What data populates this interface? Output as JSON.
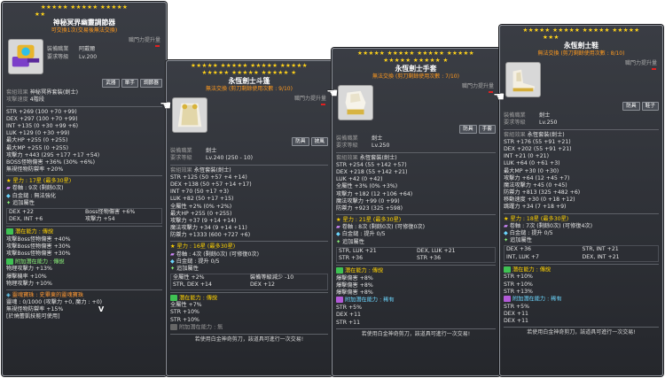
{
  "t1": {
    "stars": "★★★★★ ★★★★★ ★★★★★",
    "stars2": "★★",
    "title": "神秘冥界幽靈調節器",
    "sub": "可交換1次(交易後無法交換)",
    "power": "職門力提升量",
    "info": [
      [
        "裝備職業",
        "阿戴爾"
      ],
      [
        "要求等級",
        "Lv.200"
      ],
      [
        "套組效果",
        "神秘冥界套裝(劍士)"
      ],
      [
        "攻擊速度",
        "4階段"
      ]
    ],
    "chips": [
      "武器",
      "單手",
      "調節器"
    ],
    "stats": [
      "STR +269 (100 +70 +99)",
      "DEX +297 (100 +70 +99)",
      "INT +135 (0 +30 +99 +6)",
      "LUK +129 (0 +30 +99)",
      "最大HP +255 (0 +255)",
      "最大MP +255 (0 +255)",
      "攻擊力 +443 (295 +177 +17 +54)",
      "BOSS怪物傷害 +36% (30% +6%)",
      "無視怪物防禦率 +20%"
    ],
    "star_force": "星力 : 17星 (最多30星)",
    "rolls": "卷軸 : 9次 (剩餘0次)",
    "hammer": "白金鎚 : 無法強化",
    "extra_label": "追加屬性",
    "extra": [
      "DEX +22",
      "Boss怪物傷害 +6%",
      "DEX, INT +6",
      "攻擊力 +54"
    ],
    "pot_label": "潛在能力 : 傳說",
    "pot": [
      "攻擊Boss怪物傷害 +40%",
      "攻擊Boss怪物傷害 +30%",
      "攻擊Boss怪物傷害 +30%"
    ],
    "apot_label": "附加潛在能力 : 傳說",
    "apot": [
      "物理攻擊力 +13%",
      "爆擊機率 +10%",
      "物理攻擊力 +10%"
    ],
    "soul_title": "靈魂寶珠 : 史畢東的靈魂寶珠",
    "soul_lines": [
      "靈魂 : 0/1000 (攻擊力 +0, 魔力 : +0)",
      "無視怪物防禦率 +15%",
      "[於燒蕾凱技能可使用]"
    ],
    "v": "V"
  },
  "t2": {
    "stars": "★★★★★ ★★★★★ ★★★★★ ★★★★★",
    "stars2": "★★★★★ ★★★★★ ★★★★★ ★",
    "title": "永恆劍士斗篷",
    "sub": "無法交換 (剪刀剩餘使用次數 : 9/10)",
    "power": "職門力提升量",
    "info": [
      [
        "裝備職業",
        "劍士"
      ],
      [
        "要求等級",
        "Lv.240 (250 - 10)"
      ],
      [
        "套組效果",
        "永恆套裝(劍士)"
      ]
    ],
    "chips": [
      "防具",
      "披風"
    ],
    "stats": [
      "STR +125 (50 +57 +4 +14)",
      "DEX +138 (50 +57 +14 +17)",
      "INT +70 (50 +17 +3)",
      "LUK +82 (50 +17 +15)",
      "全屬性 +2% (0% +2%)",
      "最大HP +255 (0 +255)",
      "攻擊力 +37 (9 +14 +14)",
      "魔法攻擊力 +34 (9 +14 +11)",
      "防禦力 +1333 (600 +727 +6)"
    ],
    "star_force": "星力 : 16星 (最多30星)",
    "rolls": "卷軸 : 4次 (剩餘0次) (可修復0次)",
    "hammer": "白金鎚 : 提升 0/5",
    "extra_label": "追加屬性",
    "extra": [
      "全屬性 +2%",
      "裝備等級減少 -10",
      "STR, DEX +14",
      "DEX +12"
    ],
    "pot_label": "潛在能力 : 傳說",
    "pot": [
      "全屬性 +7%",
      "STR +10%",
      "STR +10%"
    ],
    "apot_label": "附加潛在能力 : 無",
    "foot": "若使用白金神奇剪刀，該道具可進行一次交易!"
  },
  "t3": {
    "stars": "★★★★★ ★★★★★ ★★★★★ ★★★★★",
    "stars2": "★★★★★ ★★★★★ ★",
    "title": "永恆劍士手套",
    "sub": "無法交換 (剪刀剩餘使用次數 : 7/10)",
    "power": "職門力提升量",
    "info": [
      [
        "裝備職業",
        "劍士"
      ],
      [
        "要求等級",
        "Lv.250"
      ],
      [
        "套組效果",
        "永恆套裝(劍士)"
      ]
    ],
    "chips": [
      "防具",
      "手套"
    ],
    "stats": [
      "STR +254 (55 +142 +57)",
      "DEX +218 (55 +142 +21)",
      "LUK +42 (0 +42)",
      "全屬性 +3% (0% +3%)",
      "攻擊力 +182 (12 +106 +64)",
      "魔法攻擊力 +99 (0 +99)",
      "防禦力 +923 (325 +598)"
    ],
    "star_force": "星力 : 21星 (最多30星)",
    "rolls": "卷軸 : 8次 (剩餘0次) (可修復0次)",
    "hammer": "白金鎚 : 提升 0/5",
    "extra_label": "追加屬性",
    "extra": [
      "STR, LUK +21",
      "DEX, LUK +21",
      "STR +36",
      "STR +36"
    ],
    "pot_label": "潛在能力 : 傳說",
    "pot": [
      "爆擊傷害 +8%",
      "爆擊傷害 +8%",
      "爆擊傷害 +8%"
    ],
    "apot_label": "附加潛在能力 : 稀有",
    "apot": [
      "STR +5%",
      "DEX +11",
      "STR +11"
    ],
    "foot": "若使用白金神奇剪刀，該道具可進行一次交易!"
  },
  "t4": {
    "stars": "★★★★★ ★★★★★ ★★★★★ ★★★★★",
    "stars2": "★★★",
    "title": "永恆劍士鞋",
    "sub": "無法交換 (剪刀剩餘使用次數 : 8/10)",
    "power": "職門力提升量",
    "info": [
      [
        "裝備職業",
        "劍士"
      ],
      [
        "要求等級",
        "Lv.250"
      ],
      [
        "套組效果",
        "永恆套裝(劍士)"
      ]
    ],
    "chips": [
      "防具",
      "鞋子"
    ],
    "stats": [
      "STR +176 (55 +91 +21)",
      "DEX +202 (55 +91 +21)",
      "INT +21 (0 +21)",
      "LUK +64 (0 +61 +3)",
      "最大MP +30 (0 +30)",
      "攻擊力 +64 (12 +45 +7)",
      "魔法攻擊力 +45 (0 +45)",
      "防禦力 +813 (325 +482 +6)",
      "移動速度 +30 (0 +18 +12)",
      "跳躍力 +34 (7 +18 +9)"
    ],
    "star_force": "星力 : 18星 (最多30星)",
    "rolls": "卷軸 : 7次 (剩餘0次) (可修復4次)",
    "hammer": "白金鎚 : 提升 0/5",
    "extra_label": "追加屬性",
    "extra": [
      "DEX +36",
      "STR, INT +21",
      "INT, LUK +7",
      "DEX, INT +21"
    ],
    "pot_label": "潛在能力 : 傳說",
    "pot": [
      "STR +10%",
      "STR +10%",
      "STR +13%"
    ],
    "apot_label": "附加潛在能力 : 稀有",
    "apot": [
      "STR +5%",
      "DEX +11",
      "DEX +11"
    ],
    "foot": "若使用白金神奇剪刀，該道具可進行一次交易!"
  }
}
